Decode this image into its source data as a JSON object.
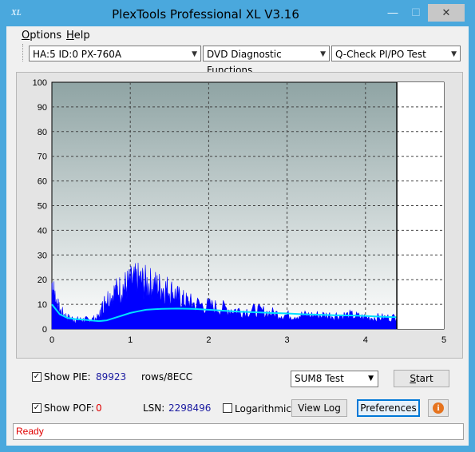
{
  "window": {
    "title": "PlexTools Professional XL V3.16",
    "app_icon_text": "XL",
    "minimize_glyph": "—",
    "maximize_glyph": "☐",
    "close_glyph": "✕"
  },
  "menu": {
    "items": [
      {
        "accel": "O",
        "rest": "ptions"
      },
      {
        "accel": "H",
        "rest": "elp"
      }
    ]
  },
  "toolbar": {
    "drive": "HA:5 ID:0  PX-760A",
    "function": "DVD Diagnostic Functions",
    "test": "Q-Check PI/PO Test"
  },
  "chart_data": {
    "type": "area",
    "xlim": [
      0,
      5
    ],
    "ylim": [
      0,
      100
    ],
    "x_ticks": [
      "0",
      "1",
      "2",
      "3",
      "4",
      "5"
    ],
    "y_ticks": [
      "0",
      "10",
      "20",
      "30",
      "40",
      "50",
      "60",
      "70",
      "80",
      "90",
      "100"
    ],
    "grid": true,
    "scan_end_x": 4.4,
    "colors": {
      "pie": "#0000ff",
      "avg": "#00e0ff",
      "marker": "#000000",
      "plot_bg_top": "#8fa4a4",
      "plot_bg_bottom": "#ffffff"
    },
    "series": [
      {
        "x": [
          0,
          0.05,
          0.1,
          0.2,
          0.3,
          0.4,
          0.5,
          0.6,
          0.65,
          0.7,
          0.8,
          0.9,
          1.0,
          1.1,
          1.2,
          1.3,
          1.4,
          1.5,
          1.6,
          1.7,
          1.8,
          2.0,
          2.2,
          2.4,
          2.6,
          2.8,
          3.0,
          3.2,
          3.4,
          3.6,
          3.8,
          4.0,
          4.2,
          4.4
        ],
        "values": [
          20,
          12,
          8,
          5,
          4,
          4,
          4,
          5,
          10,
          13,
          16,
          18,
          20,
          21,
          20,
          19,
          18,
          17,
          14,
          12,
          11,
          10,
          9,
          8,
          8,
          7,
          6,
          6,
          6,
          6,
          6,
          5,
          5,
          5
        ]
      },
      {
        "x": [
          0,
          0.05,
          0.1,
          0.2,
          0.3,
          0.4,
          0.5,
          0.6,
          0.7,
          0.8,
          0.9,
          1.0,
          1.1,
          1.2,
          1.3,
          1.4,
          1.6,
          1.8,
          2.0,
          2.2,
          2.4,
          2.6,
          2.8,
          3.0,
          3.2,
          3.4,
          3.6,
          3.8,
          4.0,
          4.2,
          4.4
        ],
        "values": [
          10,
          8,
          6,
          4.5,
          4,
          3.8,
          3.5,
          3.2,
          3.5,
          4.5,
          5.5,
          6.5,
          7.2,
          7.8,
          8.0,
          8.2,
          8.3,
          8.2,
          7.8,
          7.4,
          7.0,
          6.8,
          6.5,
          6.3,
          6.0,
          5.8,
          5.6,
          5.5,
          5.3,
          5.0,
          4.8
        ]
      }
    ]
  },
  "controls": {
    "show_pie_label": "Show PIE:",
    "pie_value": "89923",
    "pie_unit": "rows/8ECC",
    "show_pof_label": "Show POF:",
    "pof_value": "0",
    "lsn_label": "LSN:",
    "lsn_value": "2298496",
    "log_label": "Logarithmic",
    "sum_mode": "SUM8 Test",
    "start_accel": "S",
    "start_rest": "tart",
    "view_log": "View Log",
    "preferences": "Preferences",
    "info_glyph": "i",
    "check_glyph": "✓"
  },
  "status": {
    "text": "Ready"
  }
}
